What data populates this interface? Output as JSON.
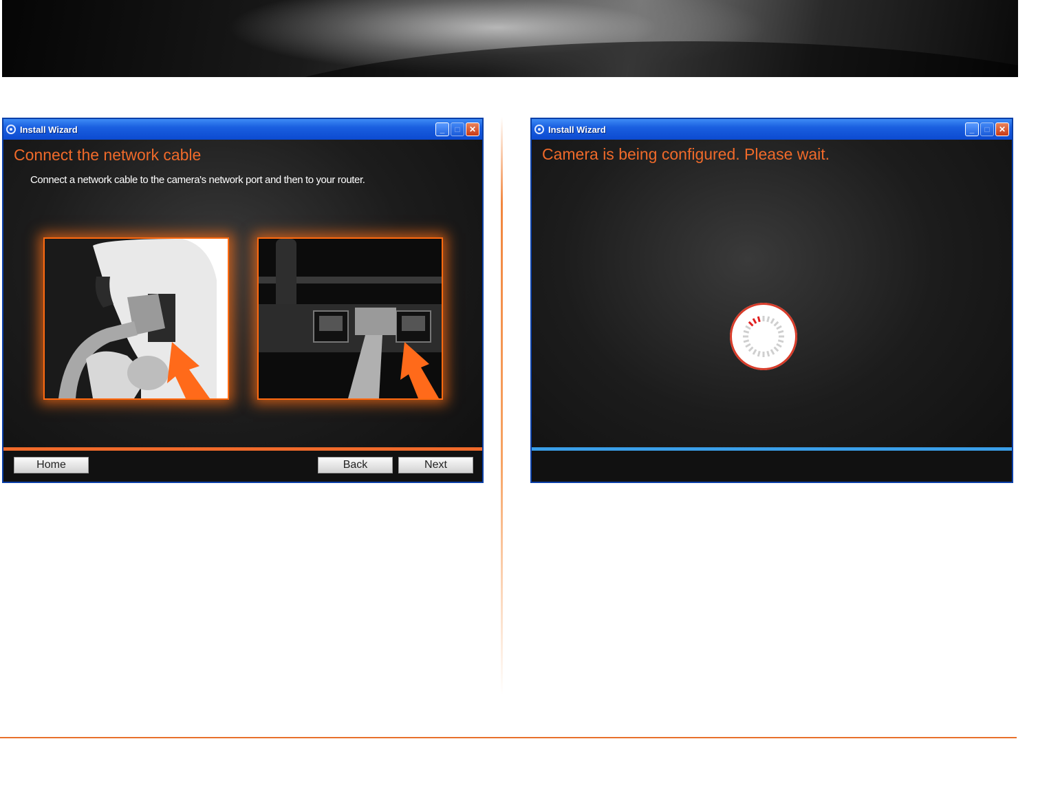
{
  "left_window": {
    "title": "Install Wizard",
    "heading": "Connect the network cable",
    "instruction": "Connect a network cable to the camera's network port and then to your router.",
    "buttons": {
      "home": "Home",
      "back": "Back",
      "next": "Next"
    },
    "accent_color": "#f06a2a"
  },
  "right_window": {
    "title": "Install Wizard",
    "heading": "Camera is being configured. Please wait.",
    "accent_color": "#3a9ee8"
  }
}
